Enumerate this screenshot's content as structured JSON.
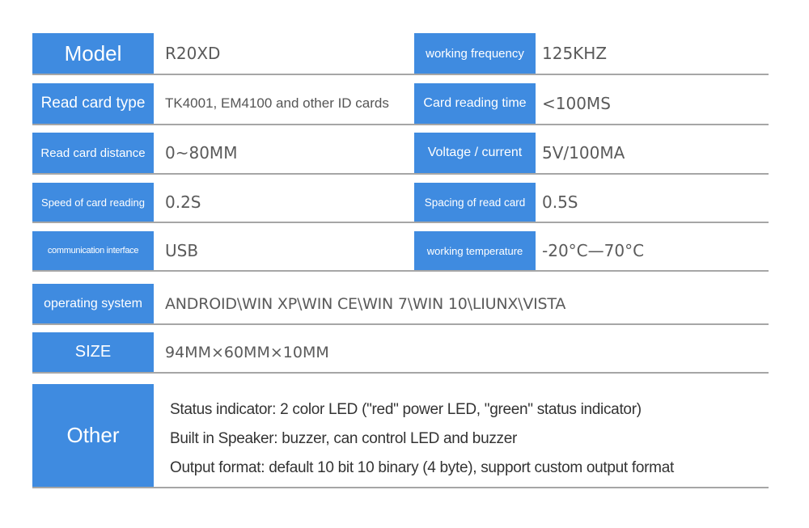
{
  "specs": {
    "rows": [
      {
        "left": {
          "label": "Model",
          "value": "R20XD"
        },
        "right": {
          "label": "working frequency",
          "value": "125KHZ"
        }
      },
      {
        "left": {
          "label": "Read card type",
          "value": "TK4001, EM4100 and other ID cards"
        },
        "right": {
          "label": "Card reading time",
          "value": "<100MS"
        }
      },
      {
        "left": {
          "label": "Read card distance",
          "value": "0~80MM"
        },
        "right": {
          "label": "Voltage / current",
          "value": "5V/100MA"
        }
      },
      {
        "left": {
          "label": "Speed of card reading",
          "value": "0.2S"
        },
        "right": {
          "label": "Spacing of read card",
          "value": "0.5S"
        }
      },
      {
        "left": {
          "label": "communication interface",
          "value": "USB"
        },
        "right": {
          "label": "working temperature",
          "value": "-20°C—70°C"
        }
      }
    ],
    "operating_system": {
      "label": "operating system",
      "value": "ANDROID\\WIN XP\\WIN CE\\WIN 7\\WIN 10\\LIUNX\\VISTA"
    },
    "size": {
      "label": "SIZE",
      "value": "94MM×60MM×10MM"
    },
    "other": {
      "label": "Other",
      "lines": [
        "Status indicator: 2 color LED (\"red\" power LED, \"green\" status indicator)",
        "Built in Speaker: buzzer, can control LED and buzzer",
        "Output format: default 10 bit 10 binary (4 byte), support custom output format"
      ]
    }
  },
  "colors": {
    "label_bg": "#3f8be0",
    "divider": "#a6a6a6",
    "value_text": "#5a5a5a"
  }
}
